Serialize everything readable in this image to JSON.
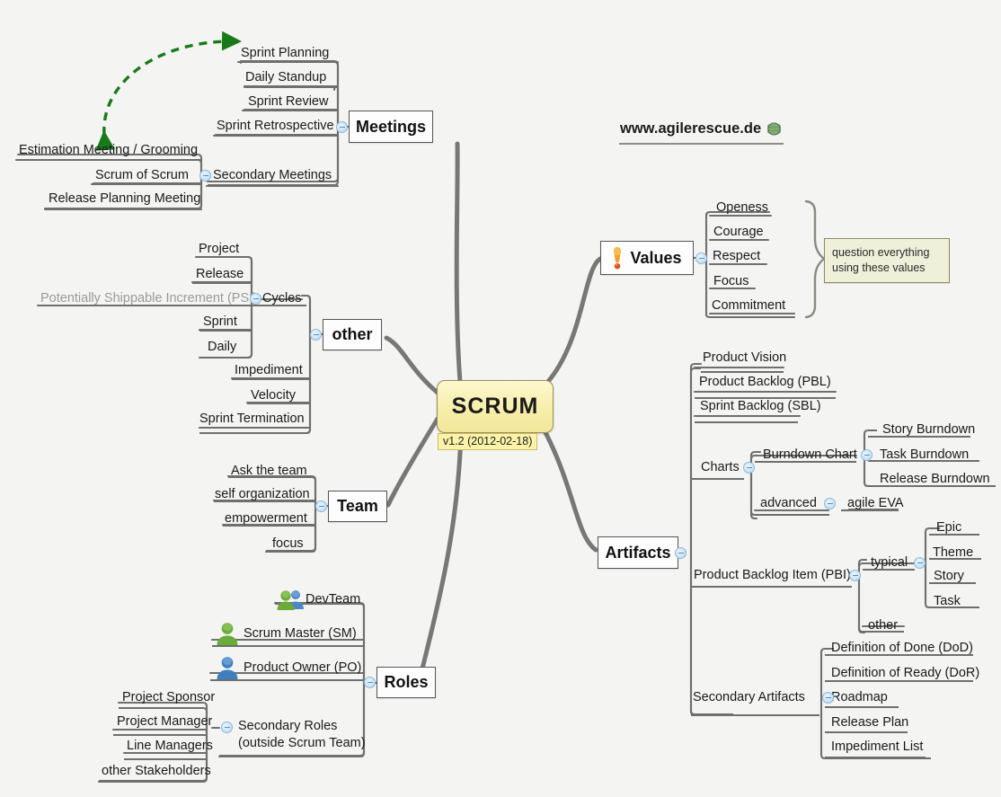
{
  "meta": {
    "background": "#f4f4f2",
    "root_fill": "#f7eeaa",
    "accent_green": "#1a7a1a",
    "callout_fill": "#eef0da",
    "toggle_fill": "#c9e2f5"
  },
  "root": {
    "label": "SCRUM",
    "version": "v1.2 (2012-02-18)"
  },
  "site": {
    "label": "www.agilerescue.de",
    "icon": "globe-icon"
  },
  "callout": {
    "line1": "question everything",
    "line2": "using these values"
  },
  "branches": {
    "meetings": {
      "label": "Meetings",
      "children": [
        {
          "label": "Sprint Planning"
        },
        {
          "label": "Daily Standup"
        },
        {
          "label": "Sprint Review"
        },
        {
          "label": "Sprint Retrospective"
        },
        {
          "label": "Secondary Meetings",
          "children": [
            {
              "label": "Estimation Meeting / Grooming"
            },
            {
              "label": "Scrum of Scrum"
            },
            {
              "label": "Release Planning Meeting"
            }
          ]
        }
      ]
    },
    "values": {
      "label": "Values",
      "icon": "exclamation-icon",
      "children": [
        {
          "label": "Openess"
        },
        {
          "label": "Courage"
        },
        {
          "label": "Respect"
        },
        {
          "label": "Focus"
        },
        {
          "label": "Commitment"
        }
      ]
    },
    "other": {
      "label": "other",
      "children": [
        {
          "label": "Cycles",
          "children": [
            {
              "label": "Project"
            },
            {
              "label": "Release"
            },
            {
              "label": "Potentially Shippable Increment (PSI)",
              "muted": true
            },
            {
              "label": "Sprint"
            },
            {
              "label": "Daily"
            }
          ]
        },
        {
          "label": "Impediment"
        },
        {
          "label": "Velocity"
        },
        {
          "label": "Sprint Termination"
        }
      ]
    },
    "team": {
      "label": "Team",
      "children": [
        {
          "label": "Ask the team"
        },
        {
          "label": "self organization"
        },
        {
          "label": "empowerment"
        },
        {
          "label": "focus"
        }
      ]
    },
    "roles": {
      "label": "Roles",
      "children": [
        {
          "label": "DevTeam",
          "icon": "people-group-icon"
        },
        {
          "label": "Scrum Master (SM)",
          "icon": "person-green-icon"
        },
        {
          "label": "Product Owner (PO)",
          "icon": "person-blue-icon"
        },
        {
          "label": "Secondary Roles",
          "label2": "(outside Scrum Team)",
          "children": [
            {
              "label": "Project Sponsor"
            },
            {
              "label": "Project Manager"
            },
            {
              "label": "Line Managers"
            },
            {
              "label": "other Stakeholders"
            }
          ]
        }
      ]
    },
    "artifacts": {
      "label": "Artifacts",
      "children": [
        {
          "label": "Product Vision"
        },
        {
          "label": "Product Backlog (PBL)"
        },
        {
          "label": "Sprint Backlog (SBL)"
        },
        {
          "label": "Charts",
          "children": [
            {
              "label": "Burndown Chart",
              "children": [
                {
                  "label": "Story Burndown"
                },
                {
                  "label": "Task Burndown"
                },
                {
                  "label": "Release Burndown"
                }
              ]
            },
            {
              "label": "advanced",
              "children": [
                {
                  "label": "agile EVA"
                }
              ]
            }
          ]
        },
        {
          "label": "Product Backlog Item (PBI)",
          "children": [
            {
              "label": "typical",
              "children": [
                {
                  "label": "Epic"
                },
                {
                  "label": "Theme"
                },
                {
                  "label": "Story"
                },
                {
                  "label": "Task"
                }
              ]
            },
            {
              "label": "other"
            }
          ]
        },
        {
          "label": "Secondary Artifacts",
          "children": [
            {
              "label": "Definition of Done (DoD)"
            },
            {
              "label": "Definition of Ready (DoR)"
            },
            {
              "label": "Roadmap"
            },
            {
              "label": "Release Plan"
            },
            {
              "label": "Impediment List"
            }
          ]
        }
      ]
    }
  }
}
